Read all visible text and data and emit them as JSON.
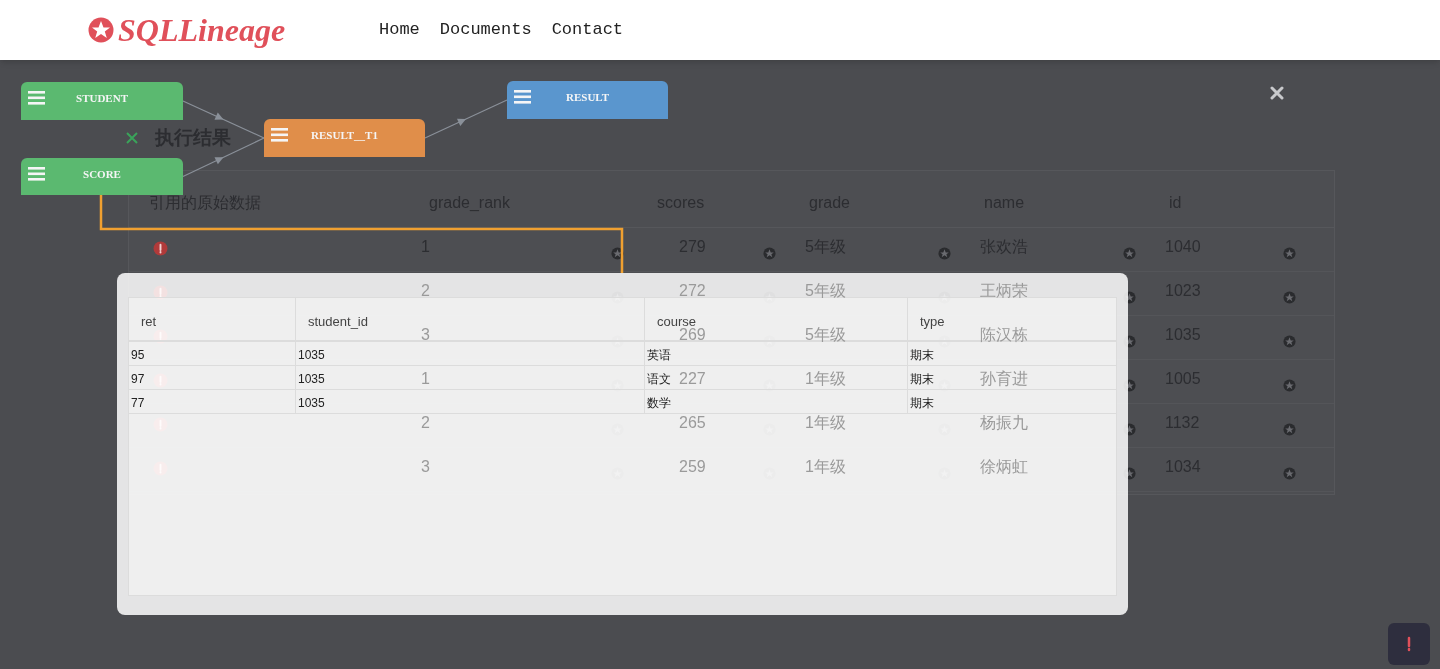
{
  "header": {
    "logo": "SQLLineage",
    "nav": [
      "Home",
      "Documents",
      "Contact"
    ]
  },
  "page": {
    "title": "执行结果",
    "table": {
      "icon_column": "引用的原始数据",
      "columns": [
        "grade_rank",
        "scores",
        "grade",
        "name",
        "id"
      ],
      "rows": [
        [
          "1",
          "279",
          "5年级",
          "张欢浩",
          "1040"
        ],
        [
          "2",
          "272",
          "5年级",
          "王炳荣",
          "1023"
        ],
        [
          "3",
          "269",
          "5年级",
          "陈汉栋",
          "1035"
        ],
        [
          "1",
          "227",
          "1年级",
          "孙育进",
          "1005"
        ],
        [
          "2",
          "265",
          "1年级",
          "杨振九",
          "1132"
        ],
        [
          "3",
          "259",
          "1年级",
          "徐炳虹",
          "1034"
        ]
      ]
    }
  },
  "lineage": {
    "nodes": [
      {
        "label": "STUDENT",
        "color": "#5cbf72"
      },
      {
        "label": "SCORE",
        "color": "#5cbf72"
      },
      {
        "label": "RESULT__T1",
        "color": "#e8924a"
      },
      {
        "label": "RESULT",
        "color": "#5b9bd5"
      }
    ]
  },
  "modal": {
    "columns": [
      "ret",
      "student_id",
      "course",
      "type"
    ],
    "rows": [
      [
        "95",
        "1035",
        "英语",
        "期末"
      ],
      [
        "97",
        "1035",
        "语文",
        "期末"
      ],
      [
        "77",
        "1035",
        "数学",
        "期末"
      ]
    ]
  }
}
